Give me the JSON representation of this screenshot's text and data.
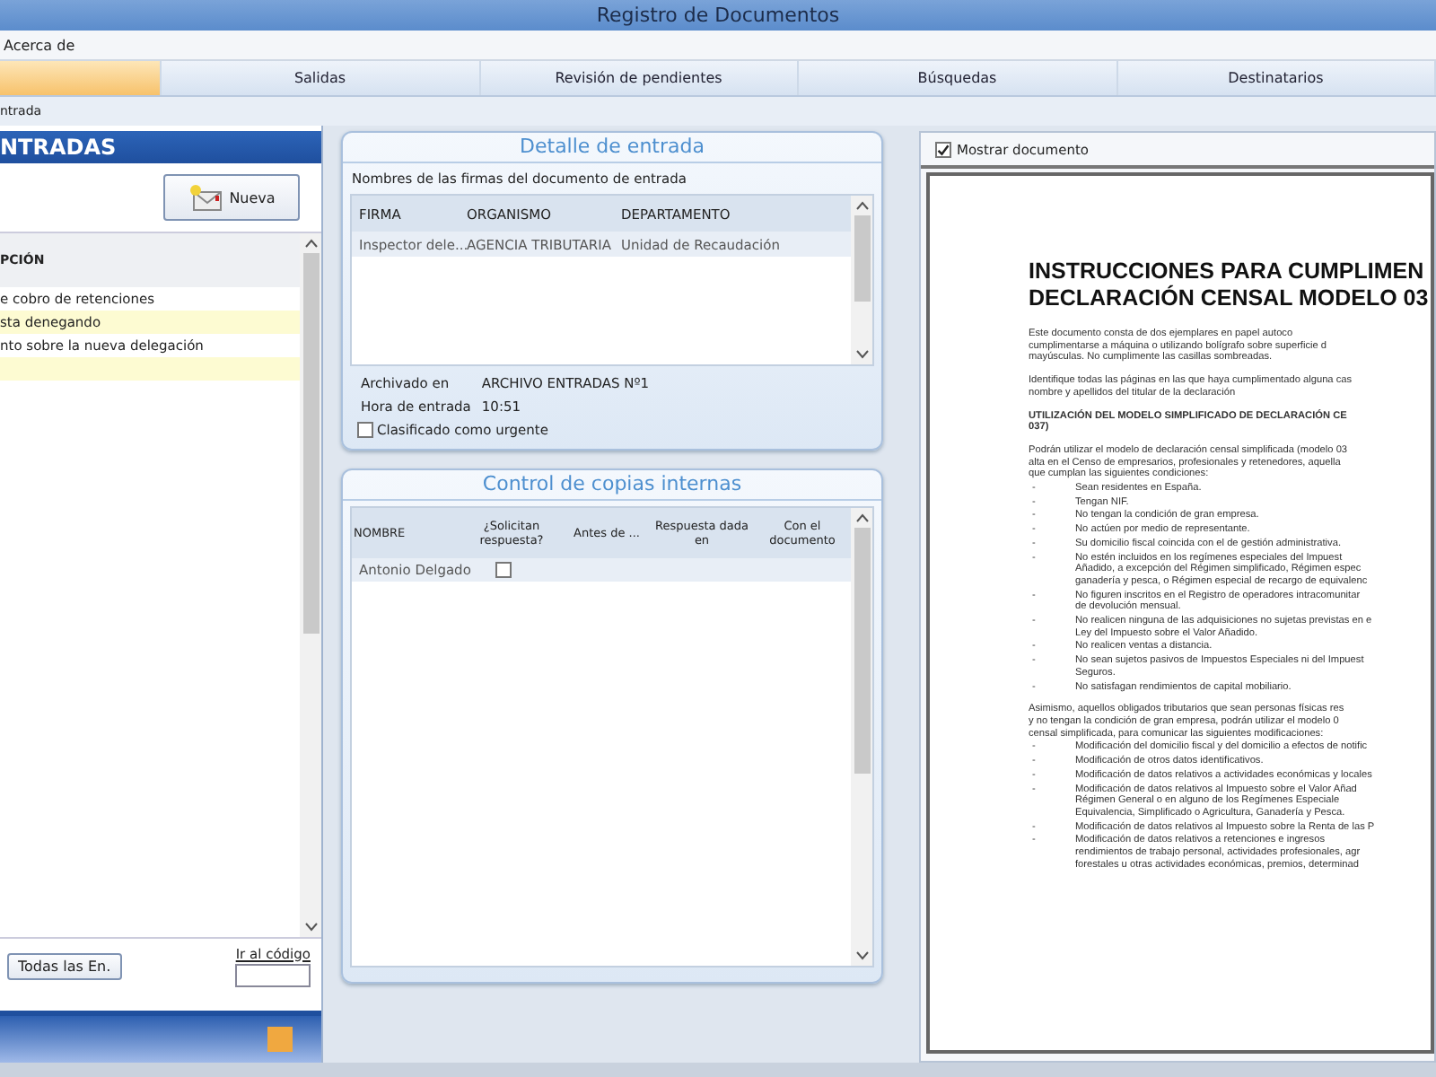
{
  "window": {
    "title": "Registro de Documentos"
  },
  "menu": [
    "Acerca de"
  ],
  "toolbar_tabs": [
    {
      "selected": true
    },
    {
      "label": "Salidas",
      "selected": false
    },
    {
      "label": "Revisión de pendientes",
      "selected": false
    },
    {
      "label": "Búsquedas",
      "selected": false
    },
    {
      "label": "Destinatarios",
      "selected": false
    }
  ],
  "breadcrumb": "ntrada",
  "entradas": {
    "title": "NTRADAS",
    "new_button": "Nueva",
    "column": "PCIÓN",
    "rows": [
      {
        "text": "e cobro de retenciones",
        "highlighted": false
      },
      {
        "text": "sta denegando",
        "highlighted": true
      },
      {
        "text": "nto sobre la nueva delegación",
        "highlighted": false
      },
      {
        "highlighted": true
      }
    ],
    "all_button": "Todas las En.",
    "goto_link": "Ir al código"
  },
  "detalle": {
    "title": "Detalle de entrada",
    "caption": "Nombres de las firmas del documento de entrada",
    "columns": [
      "FIRMA",
      "ORGANISMO",
      "DEPARTAMENTO"
    ],
    "rows": [
      [
        "Inspector dele...",
        "AGENCIA TRIBUTARIA",
        "Unidad de Recaudación"
      ]
    ],
    "archived_label": "Archivado en",
    "archived_value": "ARCHIVO ENTRADAS Nº1",
    "time_label": "Hora de entrada",
    "time_value": "10:51",
    "urgent": {
      "label": "Clasificado como urgente",
      "checked": false
    }
  },
  "copias": {
    "title": "Control de copias internas",
    "columns": [
      "NOMBRE",
      "¿Solicitan respuesta?",
      "Antes de ...",
      "Respuesta dada en",
      "Con el documento"
    ],
    "rows": [
      {
        "nombre": "Antonio Delgado",
        "solicitan": false
      }
    ]
  },
  "visor": {
    "show": {
      "label": "Mostrar documento",
      "checked": true
    },
    "document": {
      "title_lines": [
        "INSTRUCCIONES PARA CUMPLIMEN",
        "DECLARACIÓN CENSAL MODELO 03"
      ],
      "blocks": [
        {
          "kind": "para",
          "lines": [
            "Este documento consta de dos ejemplares en papel autoco",
            "cumplimentarse a máquina o utilizando bolígrafo sobre superficie d",
            "mayúsculas. No cumplimente las casillas sombreadas."
          ]
        },
        {
          "kind": "para",
          "lines": [
            "Identifique todas las páginas en las que haya cumplimentado alguna cas",
            "nombre y apellidos del titular de la declaración"
          ]
        },
        {
          "kind": "heading",
          "lines": [
            "UTILIZACIÓN DEL MODELO SIMPLIFICADO DE DECLARACIÓN CE",
            "037)"
          ]
        },
        {
          "kind": "para",
          "lines": [
            "Podrán utilizar el modelo de declaración censal simplificada (modelo 03",
            "alta en el Censo de empresarios, profesionales y retenedores, aquella",
            "que cumplan las siguientes condiciones:"
          ]
        },
        {
          "kind": "bullet",
          "marker": "-",
          "lines": [
            "Sean residentes en España."
          ]
        },
        {
          "kind": "bullet",
          "marker": "-",
          "lines": [
            "Tengan NIF."
          ]
        },
        {
          "kind": "bullet",
          "marker": "-",
          "lines": [
            "No tengan la condición de gran empresa."
          ]
        },
        {
          "kind": "bullet",
          "marker": "-",
          "lines": [
            "No actúen por medio de representante."
          ]
        },
        {
          "kind": "bullet",
          "marker": "-",
          "lines": [
            "Su domicilio fiscal coincida con el de gestión administrativa."
          ]
        },
        {
          "kind": "bullet",
          "marker": "-",
          "lines": [
            "No estén incluidos en los regímenes especiales del Impuest",
            "Añadido, a excepción del Régimen simplificado, Régimen espec",
            "ganadería y pesca, o Régimen especial de recargo de equivalenc"
          ]
        },
        {
          "kind": "bullet",
          "marker": "-",
          "lines": [
            "No figuren inscritos en el Registro de operadores intracomunitar",
            "de devolución mensual."
          ]
        },
        {
          "kind": "bullet",
          "marker": "-",
          "lines": [
            "No realicen ninguna de las adquisiciones no sujetas previstas en e",
            "Ley del Impuesto sobre el Valor Añadido."
          ]
        },
        {
          "kind": "bullet",
          "marker": "-",
          "lines": [
            "No realicen ventas a distancia."
          ]
        },
        {
          "kind": "bullet",
          "marker": "-",
          "lines": [
            "No sean sujetos pasivos de Impuestos Especiales ni del Impuest",
            "Seguros."
          ]
        },
        {
          "kind": "bullet",
          "marker": "-",
          "lines": [
            "No satisfagan rendimientos de capital mobiliario."
          ]
        },
        {
          "kind": "para",
          "lines": [
            "Asimismo, aquellos obligados tributarios que sean personas físicas res",
            "y no tengan la condición de gran empresa, podrán utilizar el modelo 0",
            "censal simplificada, para comunicar las siguientes modificaciones:"
          ]
        },
        {
          "kind": "bullet",
          "marker": "-",
          "lines": [
            "Modificación del domicilio fiscal y del domicilio a efectos de notific"
          ]
        },
        {
          "kind": "bullet",
          "marker": "-",
          "lines": [
            "Modificación de otros datos identificativos."
          ]
        },
        {
          "kind": "bullet",
          "marker": "-",
          "lines": [
            "Modificación de datos relativos a actividades económicas y locales"
          ]
        },
        {
          "kind": "bullet",
          "marker": "-",
          "lines": [
            "Modificación de datos relativos al Impuesto sobre el Valor Añad",
            "Régimen General o en alguno de los Regímenes Especiale",
            "Equivalencia, Simplificado o Agricultura, Ganadería y Pesca."
          ]
        },
        {
          "kind": "bullet",
          "marker": "-",
          "lines": [
            "Modificación de datos relativos al Impuesto sobre la Renta de las P"
          ]
        },
        {
          "kind": "bullet",
          "marker": "-",
          "lines": [
            "Modificación de datos relativos a retenciones e ingresos",
            "rendimientos de trabajo personal, actividades profesionales, agr",
            "forestales u otras actividades económicas, premios, determinad"
          ]
        }
      ]
    }
  }
}
